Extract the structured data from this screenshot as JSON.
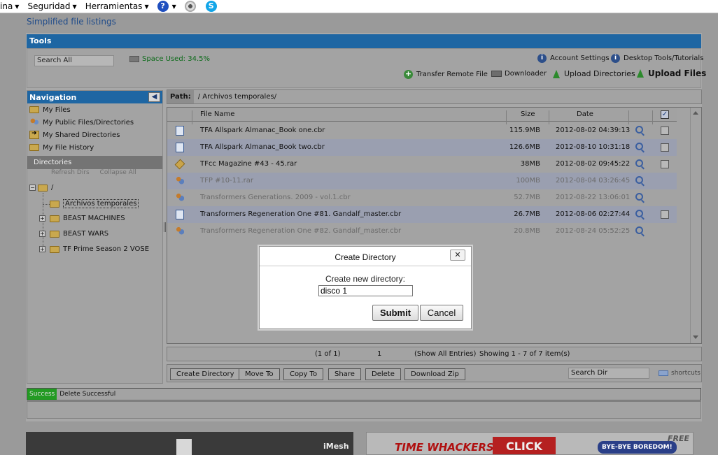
{
  "browser": {
    "menus": [
      "ina",
      "Seguridad",
      "Herramientas"
    ],
    "help_glyph": "?",
    "skype_glyph": "S"
  },
  "page": {
    "title": "Simplified file listings"
  },
  "tools": {
    "title": "Tools",
    "search_placeholder": "Search All",
    "space_used": "Space Used: 34.5%",
    "account_settings": "Account Settings",
    "desktop_tools": "Desktop Tools/Tutorials",
    "transfer_remote": "Transfer Remote File",
    "downloader": "Downloader",
    "upload_directories": "Upload Directories",
    "upload_files": "Upload Files"
  },
  "navigation": {
    "title": "Navigation",
    "collapse_glyph": "◀",
    "items": [
      {
        "label": "My Files",
        "icon": "folder-icon"
      },
      {
        "label": "My Public Files/Directories",
        "icon": "users-icon"
      },
      {
        "label": "My Shared Directories",
        "icon": "shared-folder-icon"
      },
      {
        "label": "My File History",
        "icon": "folder-icon"
      }
    ],
    "directories_title": "Directories",
    "refresh_dirs": "Refresh Dirs",
    "collapse_all": "Collapse All",
    "tree": {
      "root": "/",
      "root_toggle": "−",
      "children": [
        {
          "label": "Archivos temporales",
          "toggle": ""
        },
        {
          "label": "BEAST MACHINES",
          "toggle": "+"
        },
        {
          "label": "BEAST WARS",
          "toggle": "+"
        },
        {
          "label": "TF Prime Season 2 VOSE",
          "toggle": "+"
        }
      ]
    }
  },
  "path": {
    "label": "Path:",
    "value": "/ Archivos temporales/"
  },
  "file_list": {
    "headers": {
      "name": "File Name",
      "size": "Size",
      "date": "Date",
      "select_all_glyph": "✓"
    },
    "rows": [
      {
        "name": "TFA Allspark Almanac_Book one.cbr",
        "size": "115.9MB",
        "date": "2012-08-02 04:39:13",
        "icon": "document-icon",
        "checkbox": true,
        "dim": false,
        "alt": false
      },
      {
        "name": "TFA Allspark Almanac_Book two.cbr",
        "size": "126.6MB",
        "date": "2012-08-10 10:31:18",
        "icon": "document-icon",
        "checkbox": true,
        "dim": false,
        "alt": true
      },
      {
        "name": "TFcc Magazine #43 - 45.rar",
        "size": "38MB",
        "date": "2012-08-02 09:45:22",
        "icon": "archive-icon",
        "checkbox": true,
        "dim": false,
        "alt": false
      },
      {
        "name": "TFP #10-11.rar",
        "size": "100MB",
        "date": "2012-08-04 03:26:45",
        "icon": "shared-users-icon",
        "checkbox": false,
        "dim": true,
        "alt": true
      },
      {
        "name": "Transformers Generations. 2009 - vol.1.cbr",
        "size": "52.7MB",
        "date": "2012-08-22 13:06:01",
        "icon": "shared-users-icon",
        "checkbox": false,
        "dim": true,
        "alt": false
      },
      {
        "name": "Transformers Regeneration One #81. Gandalf_master.cbr",
        "size": "26.7MB",
        "date": "2012-08-06 02:27:44",
        "icon": "document-icon",
        "checkbox": true,
        "dim": false,
        "alt": true
      },
      {
        "name": "Transformers Regeneration One #82. Gandalf_master.cbr",
        "size": "20.8MB",
        "date": "2012-08-24 05:52:25",
        "icon": "shared-users-icon",
        "checkbox": false,
        "dim": true,
        "alt": false
      }
    ]
  },
  "pager": {
    "of": "(1 of 1)",
    "page": "1",
    "show_all": "(Show All Entries)",
    "showing": "Showing 1 - 7 of 7 item(s)"
  },
  "actions": {
    "create_directory": "Create Directory",
    "move_to": "Move To",
    "copy_to": "Copy To",
    "share": "Share",
    "delete": "Delete",
    "download_zip": "Download Zip",
    "search_dir_placeholder": "Search Dir",
    "shortcuts": "shortcuts"
  },
  "status": {
    "badge": "Success",
    "message": "Delete Successful"
  },
  "ads": {
    "left_brand": "iMesh",
    "right_title": "TIME WHACKERS",
    "right_click": "CLICK",
    "right_bye": "BYE-BYE BOREDOM!",
    "right_free": "FREE"
  },
  "modal": {
    "title": "Create Directory",
    "close_glyph": "✕",
    "label": "Create new directory:",
    "input_value": "disco 1",
    "submit": "Submit",
    "cancel": "Cancel"
  }
}
